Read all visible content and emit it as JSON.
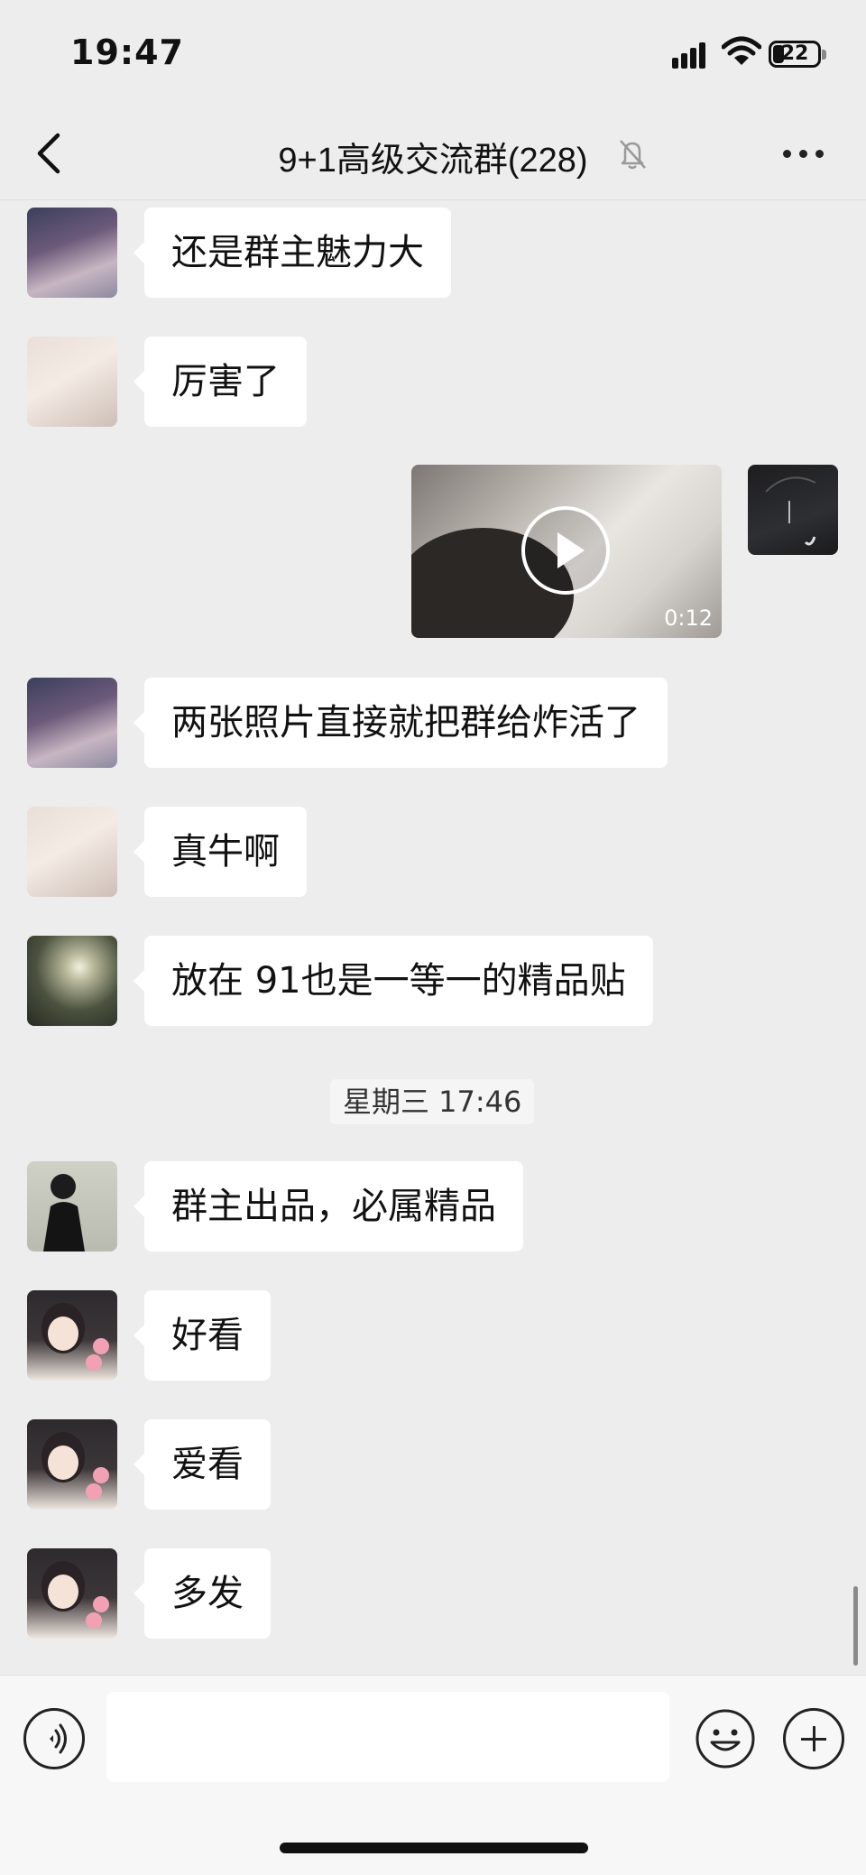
{
  "status_bar": {
    "time": "19:47",
    "battery_level": "22",
    "icons": [
      "signal-icon",
      "wifi-icon",
      "battery-icon"
    ]
  },
  "nav": {
    "title": "9+1高级交流群(228)",
    "back_icon": "chevron-left-icon",
    "mute_icon": "bell-muted-icon",
    "more_icon": "more-icon"
  },
  "messages": [
    {
      "type": "text",
      "text": "还是群主魅力大"
    },
    {
      "type": "text",
      "text": "厉害了"
    },
    {
      "type": "video",
      "duration": "0:12"
    },
    {
      "type": "text",
      "text": "两张照片直接就把群给炸活了"
    },
    {
      "type": "text",
      "text": "真牛啊"
    },
    {
      "type": "text",
      "text": "放在 91也是一等一的精品贴"
    },
    {
      "type": "time",
      "text": "星期三 17:46"
    },
    {
      "type": "text",
      "text": "群主出品，必属精品"
    },
    {
      "type": "text",
      "text": "好看"
    },
    {
      "type": "text",
      "text": "爱看"
    },
    {
      "type": "text",
      "text": "多发"
    }
  ],
  "input_bar": {
    "placeholder": "",
    "icons": [
      "voice-icon",
      "emoji-icon",
      "plus-icon"
    ]
  },
  "colors": {
    "background": "#ededed",
    "bubble": "#ffffff",
    "input_bar": "#f7f7f7"
  }
}
